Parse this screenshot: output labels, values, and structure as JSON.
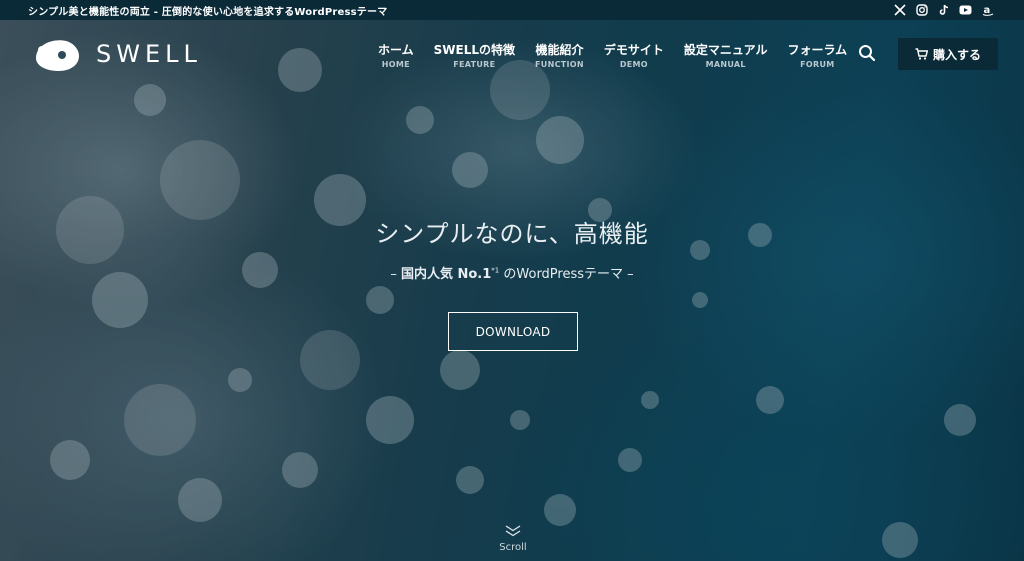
{
  "topbar": {
    "tagline": "シンプル美と機能性の両立 - 圧倒的な使い心地を追求するWordPressテーマ",
    "social": [
      "x-icon",
      "instagram-icon",
      "tiktok-icon",
      "youtube-icon",
      "amazon-icon"
    ]
  },
  "header": {
    "logo_text": "SWELL",
    "nav": [
      {
        "ja": "ホーム",
        "en": "HOME"
      },
      {
        "ja": "SWELLの特徴",
        "en": "FEATURE"
      },
      {
        "ja": "機能紹介",
        "en": "FUNCTION"
      },
      {
        "ja": "デモサイト",
        "en": "DEMO"
      },
      {
        "ja": "設定マニュアル",
        "en": "MANUAL"
      },
      {
        "ja": "フォーラム",
        "en": "FORUM"
      }
    ],
    "buy_label": "購入する"
  },
  "hero": {
    "title": "シンプルなのに、高機能",
    "sub_dash_left": "–",
    "sub_bold": "国内人気 No.1",
    "sub_note": "*1",
    "sub_rest": " のWordPressテーマ",
    "sub_dash_right": "–",
    "download_label": "DOWNLOAD",
    "scroll_label": "Scroll"
  },
  "colors": {
    "topbar_bg": "#0b2a38",
    "buy_button_bg": "#0b2a38",
    "text": "#ffffff"
  }
}
